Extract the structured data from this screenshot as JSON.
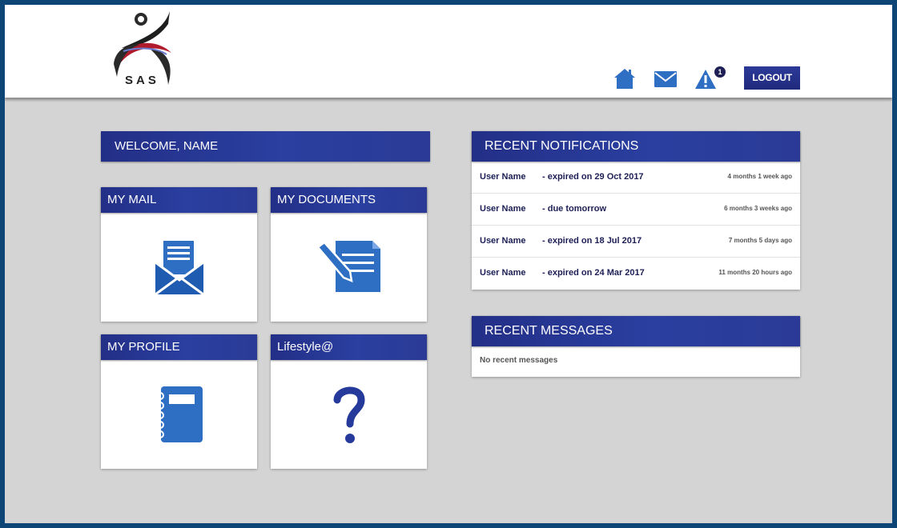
{
  "header": {
    "logo_text": "SAS",
    "logout_label": "LOGOUT",
    "alert_count": "1",
    "icons": [
      "home-icon",
      "mail-icon",
      "alert-icon"
    ]
  },
  "welcome": {
    "label": "WELCOME, NAME"
  },
  "tiles": [
    {
      "label": "MY MAIL",
      "icon": "open-envelope-icon"
    },
    {
      "label": "MY DOCUMENTS",
      "icon": "document-pencil-icon"
    },
    {
      "label": "MY PROFILE",
      "icon": "notebook-icon"
    },
    {
      "label": "Lifestyle@",
      "icon": "question-mark-icon"
    }
  ],
  "notifications": {
    "title": "RECENT NOTIFICATIONS",
    "items": [
      {
        "user": "User Name",
        "text": "- expired on 29 Oct 2017",
        "time": "4 months 1 week ago"
      },
      {
        "user": "User Name",
        "text": "- due tomorrow",
        "time": "6 months 3 weeks ago"
      },
      {
        "user": "User Name",
        "text": "- expired on 18 Jul 2017",
        "time": "7 months 5 days ago"
      },
      {
        "user": "User Name",
        "text": "- expired on 24 Mar 2017",
        "time": "11 months 20 hours ago"
      }
    ]
  },
  "messages": {
    "title": "RECENT MESSAGES",
    "empty_text": "No recent messages"
  },
  "colors": {
    "page_background": "#d4d4d4",
    "frame_border": "#0c4576",
    "accent_blue": "#2a3fa0",
    "icon_blue": "#2e6fc4",
    "text_navy": "#1d1f55"
  }
}
